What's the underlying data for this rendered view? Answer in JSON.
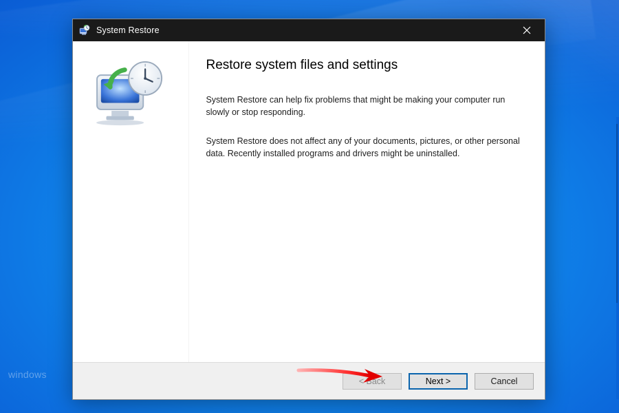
{
  "desktop": {
    "watermark": "windows"
  },
  "titlebar": {
    "title": "System Restore"
  },
  "content": {
    "heading": "Restore system files and settings",
    "paragraphs": [
      "System Restore can help fix problems that might be making your computer run slowly or stop responding.",
      "System Restore does not affect any of your documents, pictures, or other personal data. Recently installed programs and drivers might be uninstalled."
    ]
  },
  "footer": {
    "buttons": {
      "back": "< Back",
      "next": "Next >",
      "cancel": "Cancel"
    }
  }
}
